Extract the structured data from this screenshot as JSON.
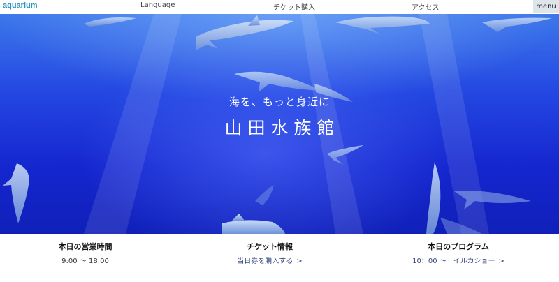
{
  "header": {
    "logo": "aquarium",
    "nav": {
      "language": "Language",
      "tickets": "チケット購入",
      "access": "アクセス"
    },
    "menu_label": "menu"
  },
  "hero": {
    "tagline": "海を、もっと身近に",
    "title": "山田水族館"
  },
  "info": {
    "hours": {
      "title": "本日の営業時間",
      "value": "9:00 〜 18:00"
    },
    "tickets": {
      "title": "チケット情報",
      "link": "当日券を購入する"
    },
    "program": {
      "title": "本日のプログラム",
      "link": "10：00 〜　イルカショー"
    }
  },
  "icons": {
    "chevron": "chevron-right-icon"
  },
  "colors": {
    "logo": "#2a93bd",
    "ocean_deep": "#1526cf",
    "ocean_light": "#3d77ea",
    "menu_bg": "#dde5ea"
  }
}
